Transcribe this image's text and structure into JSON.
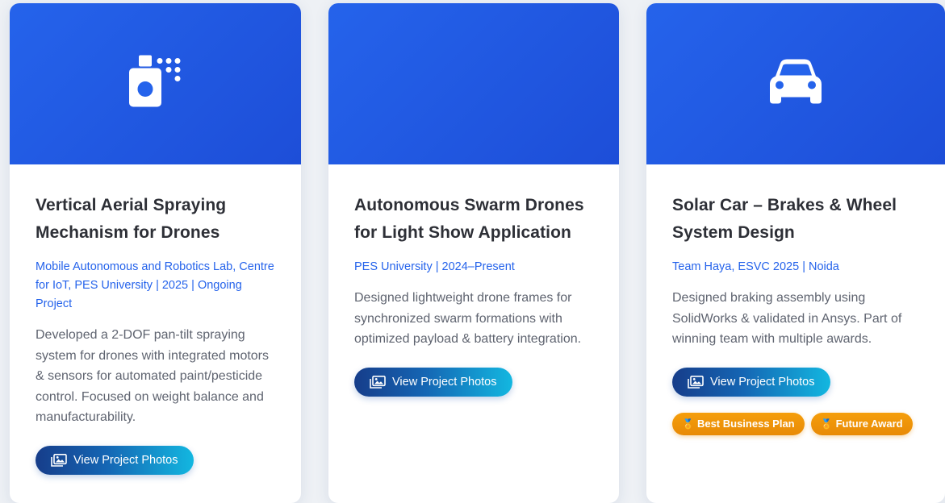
{
  "theme": {
    "hero_color": "#2563eb",
    "meta_color": "#2563eb",
    "badge_color": "#f59e0b"
  },
  "cards": [
    {
      "icon": "spray-bottle-icon",
      "title": "Vertical Aerial Spraying Mechanism for Drones",
      "meta": "Mobile Autonomous and Robotics Lab, Centre for IoT, PES University | 2025 | Ongoing Project",
      "description": "Developed a 2-DOF pan-tilt spraying system for drones with integrated motors & sensors for automated paint/pesticide control. Focused on weight balance and manufacturability.",
      "button_label": "View Project Photos"
    },
    {
      "icon": "",
      "title": "Autonomous Swarm Drones for Light Show Application",
      "meta": "PES University | 2024–Present",
      "description": "Designed lightweight drone frames for synchronized swarm formations with optimized payload & battery integration.",
      "button_label": "View Project Photos"
    },
    {
      "icon": "car-icon",
      "title": "Solar Car – Brakes & Wheel System Design",
      "meta": "Team Haya, ESVC 2025 | Noida",
      "description": "Designed braking assembly using SolidWorks & validated in Ansys. Part of winning team with multiple awards.",
      "button_label": "View Project Photos",
      "badges": [
        {
          "icon": "medal-icon",
          "label": "Best Business Plan"
        },
        {
          "icon": "medal-icon",
          "label": "Future Award"
        }
      ]
    }
  ]
}
